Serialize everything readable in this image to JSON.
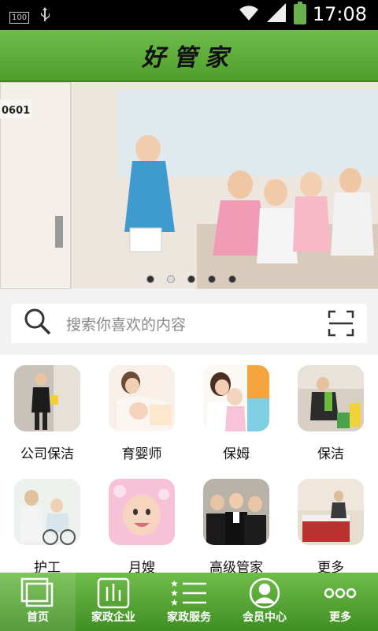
{
  "status_bar": {
    "battery_text": "100",
    "time": "17:08"
  },
  "header": {
    "title": "好管家"
  },
  "banner": {
    "door_number": "0601",
    "slides": 5,
    "active_slide": 2
  },
  "search": {
    "placeholder": "搜索你喜欢的内容"
  },
  "services": [
    {
      "label": "公司保洁"
    },
    {
      "label": "育婴师"
    },
    {
      "label": "保姆"
    },
    {
      "label": "保洁"
    },
    {
      "label": "护工"
    },
    {
      "label": "月嫂"
    },
    {
      "label": "高级管家"
    },
    {
      "label": "更多"
    }
  ],
  "tabbar": {
    "items": [
      {
        "label": "首页",
        "icon": "home-icon",
        "active": true
      },
      {
        "label": "家政企业",
        "icon": "chart-icon"
      },
      {
        "label": "家政服务",
        "icon": "list-icon"
      },
      {
        "label": "会员中心",
        "icon": "user-icon"
      },
      {
        "label": "更多",
        "icon": "more-icon"
      }
    ]
  },
  "colors": {
    "brand_green": "#5aa935",
    "dark_green": "#3e8a22"
  }
}
